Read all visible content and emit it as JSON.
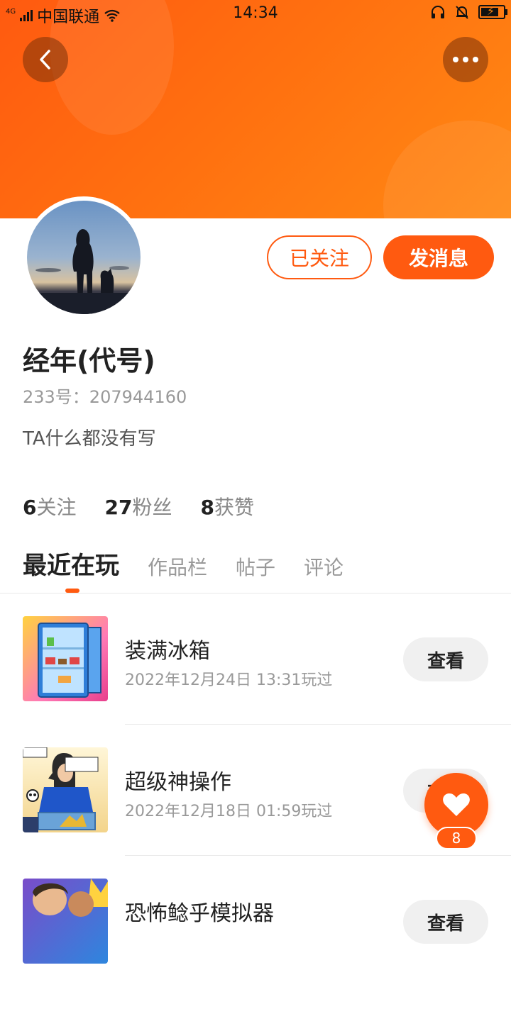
{
  "status_bar": {
    "network": "4G",
    "carrier": "中国联通",
    "time": "14:34"
  },
  "profile": {
    "name": "经年(代号)",
    "id_label": "233号：207944160",
    "bio": "TA什么都没有写",
    "follow_button": "已关注",
    "message_button": "发消息"
  },
  "stats": [
    {
      "value": "6",
      "label": "关注"
    },
    {
      "value": "27",
      "label": "粉丝"
    },
    {
      "value": "8",
      "label": "获赞"
    }
  ],
  "tabs": [
    {
      "label": "最近在玩",
      "active": true
    },
    {
      "label": "作品栏",
      "active": false
    },
    {
      "label": "帖子",
      "active": false
    },
    {
      "label": "评论",
      "active": false
    }
  ],
  "games": [
    {
      "title": "装满冰箱",
      "played": "2022年12月24日 13:31玩过",
      "button": "查看"
    },
    {
      "title": "超级神操作",
      "played": "2022年12月18日 01:59玩过",
      "button": "查看"
    },
    {
      "title": "恐怖鲶乎模拟器",
      "played": "",
      "button": "查看"
    }
  ],
  "like_fab": {
    "count": "8"
  },
  "colors": {
    "accent": "#ff5a10",
    "header_gradient_end": "#ff8a14"
  }
}
